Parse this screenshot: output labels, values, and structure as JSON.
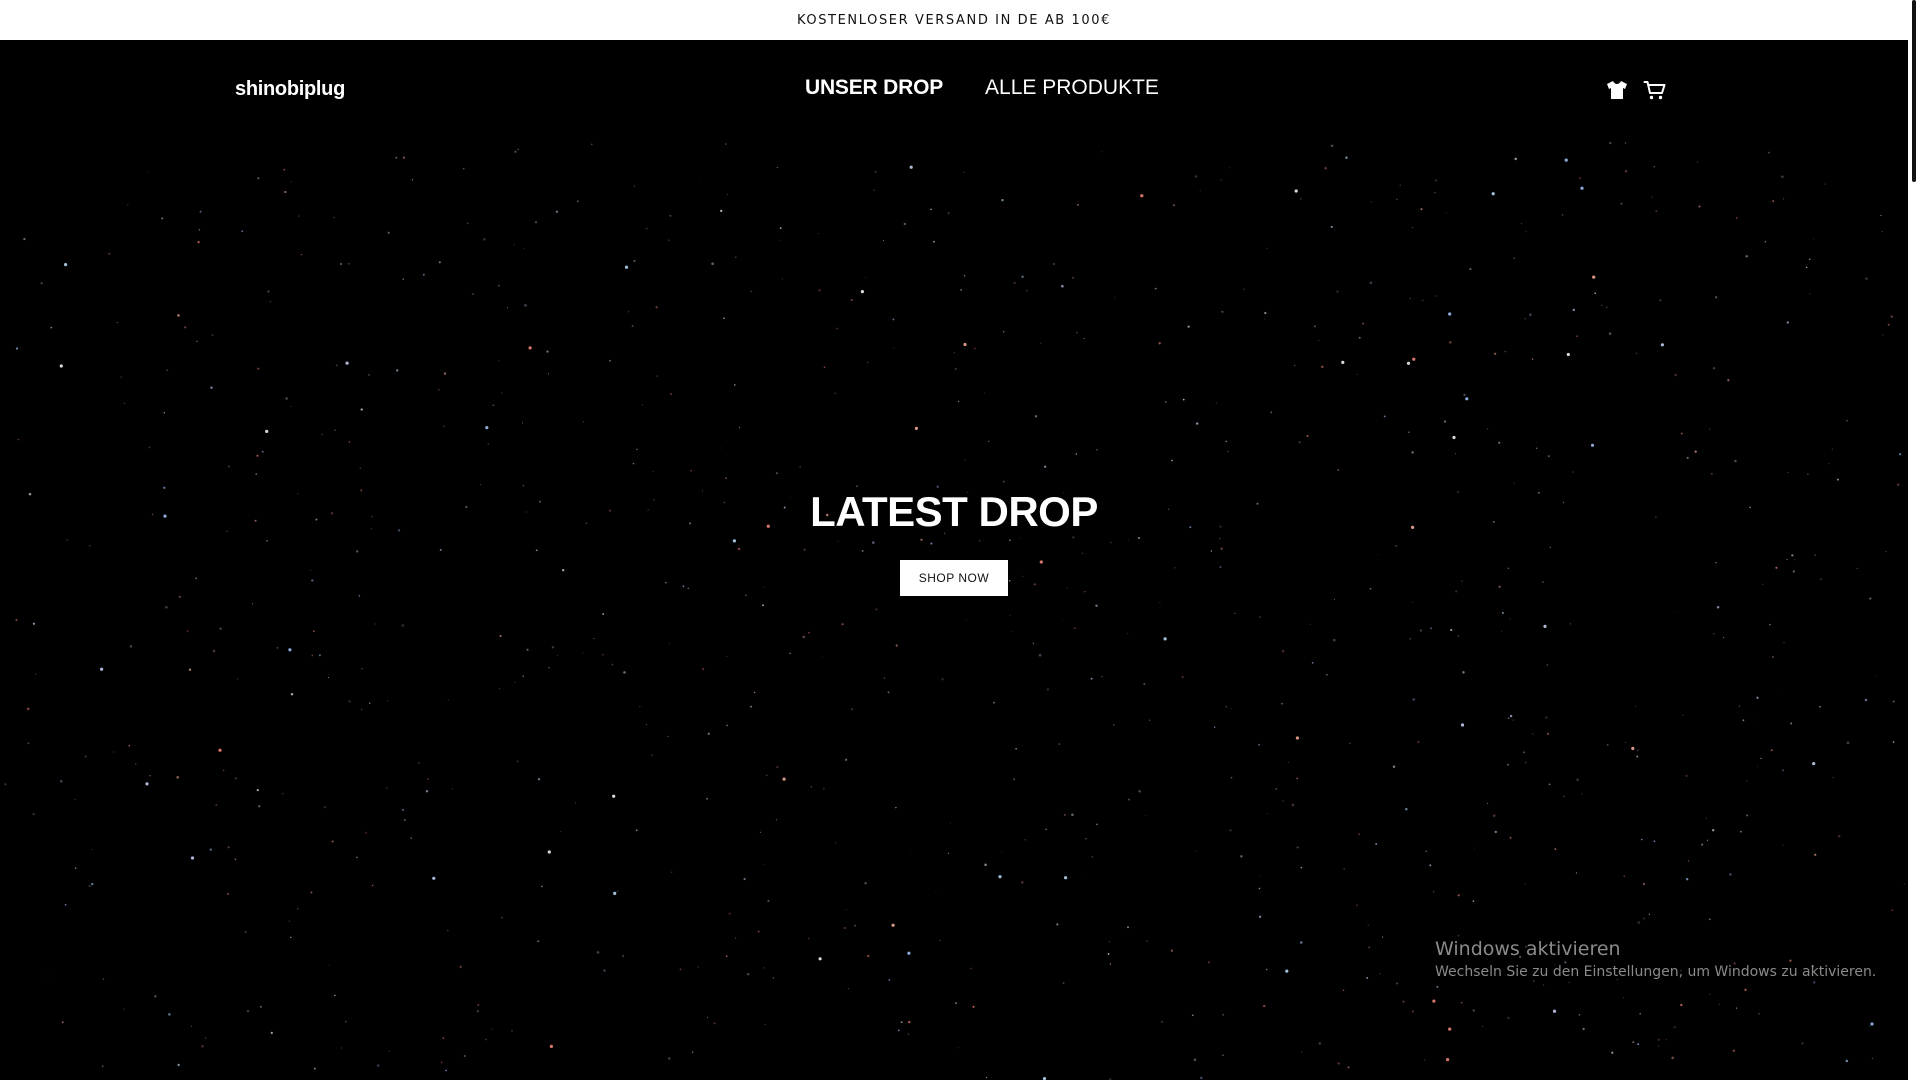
{
  "announcement": {
    "text": "KOSTENLOSER VERSAND IN DE  AB 100€"
  },
  "header": {
    "logo": "shinobiplug",
    "nav": [
      {
        "label": "UNSER DROP"
      },
      {
        "label": "ALLE PRODUKTE"
      }
    ],
    "icons": [
      "tshirt-icon",
      "cart-icon"
    ]
  },
  "hero": {
    "title": "LATEST DROP",
    "button_label": "SHOP NOW"
  },
  "windows_watermark": {
    "title": "Windows aktivieren",
    "subtitle": "Wechseln Sie zu den Einstellungen, um Windows zu aktivieren."
  },
  "colors": {
    "background": "#000000",
    "announcement_bg": "#ffffff",
    "text_light": "#ffffff"
  }
}
